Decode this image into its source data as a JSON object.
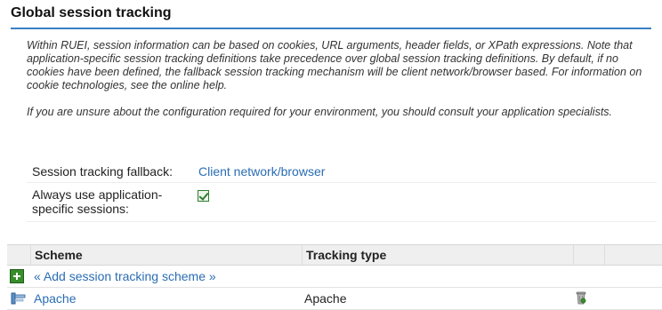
{
  "page": {
    "title": "Global session tracking"
  },
  "intro": {
    "paragraph1": "Within RUEI, session information can be based on cookies, URL arguments, header fields, or XPath expressions. Note that application-specific session tracking definitions take precedence over global session tracking definitions. By default, if no cookies have been defined, the fallback session tracking mechanism will be client network/browser based. For information on cookie technologies, see the online help.",
    "paragraph2": "If you are unsure about the configuration required for your environment, you should consult your application specialists."
  },
  "settings": {
    "fallback_label": "Session tracking fallback:",
    "fallback_value": "Client network/browser",
    "always_use_label": "Always use application-specific sessions:",
    "always_use_checked": true
  },
  "table": {
    "columns": [
      "Scheme",
      "Tracking type"
    ],
    "add_link": "« Add session tracking scheme »",
    "rows": [
      {
        "scheme": "Apache",
        "tracking_type": "Apache"
      }
    ]
  },
  "colors": {
    "link": "#2a6db3",
    "accent": "#3b7fc4",
    "add": "#3a8d2c"
  }
}
